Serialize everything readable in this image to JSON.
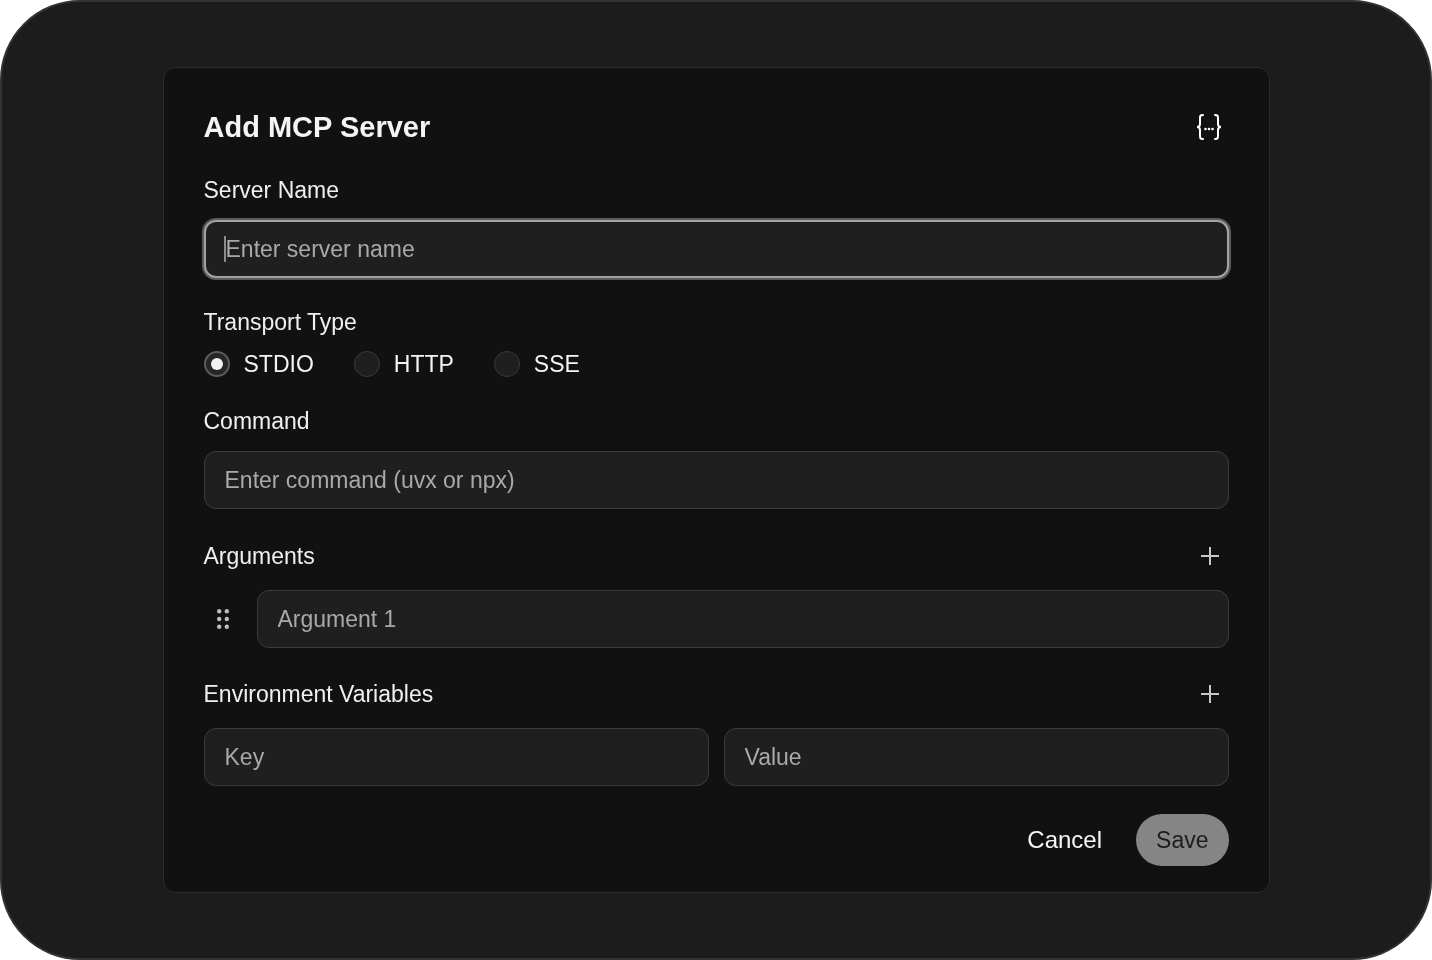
{
  "title": "Add MCP Server",
  "server_name": {
    "label": "Server Name",
    "placeholder": "Enter server name",
    "focused": true
  },
  "transport_type": {
    "label": "Transport Type",
    "options": [
      {
        "label": "STDIO",
        "selected": true
      },
      {
        "label": "HTTP",
        "selected": false
      },
      {
        "label": "SSE",
        "selected": false
      }
    ]
  },
  "command": {
    "label": "Command",
    "placeholder": "Enter command (uvx or npx)"
  },
  "arguments": {
    "label": "Arguments",
    "items": [
      {
        "placeholder": "Argument 1"
      }
    ]
  },
  "environment_variables": {
    "label": "Environment Variables",
    "items": [
      {
        "key": {
          "placeholder": "Key"
        },
        "value": {
          "placeholder": "Value"
        }
      }
    ]
  },
  "buttons": [
    {
      "label": "Cancel",
      "kind": "text",
      "disabled": false
    },
    {
      "label": "Save",
      "kind": "primary",
      "disabled": true
    }
  ]
}
